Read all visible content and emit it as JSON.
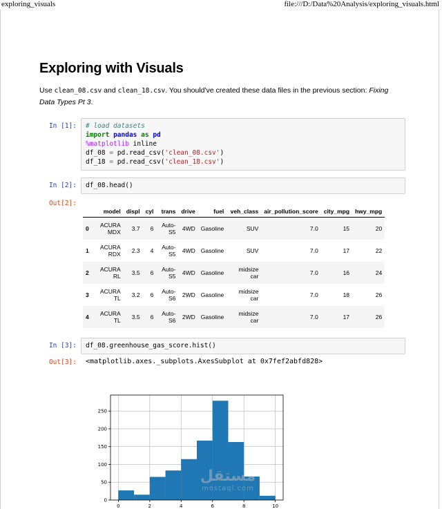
{
  "print_header": {
    "title": "exploring_visuals",
    "url": "file:///D:/Data%20Analysis/exploring_visuals.html"
  },
  "heading": "Exploring with Visuals",
  "intro": {
    "use": "Use",
    "file1": "clean_08.csv",
    "and": "and",
    "file2": "clean_18.csv",
    "after": ". You should've created these data files in the previous section:",
    "ref": "Fixing Data Types Pt 3",
    "end": "."
  },
  "cells": {
    "in1_prompt": "In [1]:",
    "in1_line1": "# load datasets",
    "in1_line2_kw": "import",
    "in1_line2_mod": "pandas",
    "in1_line2_as": "as",
    "in1_line2_alias": "pd",
    "in1_line3_magic": "%matplotlib",
    "in1_line3_rest": "inline",
    "in1_line4_a": "df_08 ",
    "in1_line4_eq": "=",
    "in1_line4_b": " pd.read_csv(",
    "in1_line4_str": "'clean_08.csv'",
    "in1_line4_c": ")",
    "in1_line5_a": "df_18 ",
    "in1_line5_eq": "=",
    "in1_line5_b": " pd.read_csv(",
    "in1_line5_str": "'clean_18.csv'",
    "in1_line5_c": ")",
    "in2_prompt": "In [2]:",
    "in2_code": "df_08.head()",
    "out2_prompt": "Out[2]:",
    "in3_prompt": "In [3]:",
    "in3_code": "df_08.greenhouse_gas_score.hist()",
    "out3_prompt": "Out[3]:",
    "out3_text": "<matplotlib.axes._subplots.AxesSubplot at 0x7fef2abfd828>"
  },
  "table": {
    "columns": [
      "",
      "model",
      "displ",
      "cyl",
      "trans",
      "drive",
      "fuel",
      "veh_class",
      "air_pollution_score",
      "city_mpg",
      "hwy_mpg"
    ],
    "rows": [
      [
        "0",
        "ACURA MDX",
        "3.7",
        "6",
        "Auto-S5",
        "4WD",
        "Gasoline",
        "SUV",
        "7.0",
        "15",
        "20"
      ],
      [
        "1",
        "ACURA RDX",
        "2.3",
        "4",
        "Auto-S5",
        "4WD",
        "Gasoline",
        "SUV",
        "7.0",
        "17",
        "22"
      ],
      [
        "2",
        "ACURA RL",
        "3.5",
        "6",
        "Auto-S5",
        "4WD",
        "Gasoline",
        "midsize car",
        "7.0",
        "16",
        "24"
      ],
      [
        "3",
        "ACURA TL",
        "3.2",
        "6",
        "Auto-S6",
        "2WD",
        "Gasoline",
        "midsize car",
        "7.0",
        "18",
        "26"
      ],
      [
        "4",
        "ACURA TL",
        "3.5",
        "6",
        "Auto-S6",
        "2WD",
        "Gasoline",
        "midsize car",
        "7.0",
        "17",
        "26"
      ]
    ]
  },
  "chart_data": {
    "type": "bar",
    "bin_edges": [
      0,
      1,
      2,
      3,
      4,
      5,
      6,
      7,
      8,
      9,
      10
    ],
    "values": [
      27,
      15,
      65,
      83,
      115,
      167,
      279,
      163,
      66,
      12
    ],
    "x_ticks": [
      "0",
      "2",
      "4",
      "6",
      "8",
      "10"
    ],
    "y_ticks": [
      "0",
      "50",
      "100",
      "150",
      "200",
      "250"
    ],
    "xlim": [
      -0.5,
      10.5
    ],
    "ylim": [
      0,
      295
    ],
    "grid": true,
    "bar_color": "#1f77b4"
  },
  "watermark": {
    "arabic": "مستقل",
    "latin": "mostaql.com"
  }
}
